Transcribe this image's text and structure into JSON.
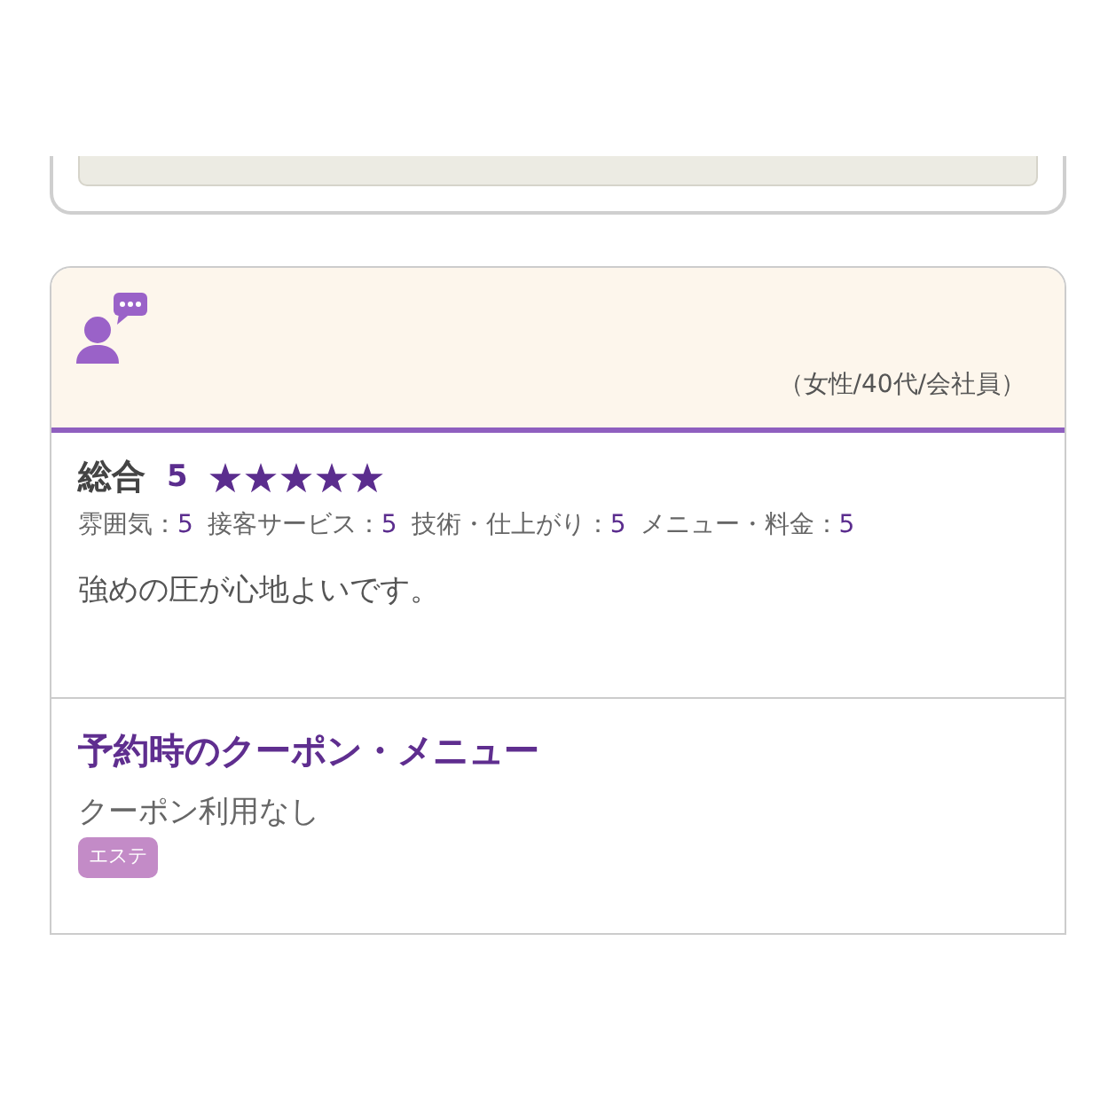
{
  "review": {
    "reviewer": {
      "profile": "（女性/40代/会社員）"
    },
    "overall": {
      "label": "総合",
      "score": "5",
      "stars": 5
    },
    "ratings": [
      {
        "label": "雰囲気：",
        "value": "5"
      },
      {
        "label": "接客サービス：",
        "value": "5"
      },
      {
        "label": "技術・仕上がり：",
        "value": "5"
      },
      {
        "label": "メニュー・料金：",
        "value": "5"
      }
    ],
    "comment": "強めの圧が心地よいです。"
  },
  "coupon": {
    "heading": "予約時のクーポン・メニュー",
    "text": "クーポン利用なし",
    "tags": [
      "エステ"
    ]
  }
}
